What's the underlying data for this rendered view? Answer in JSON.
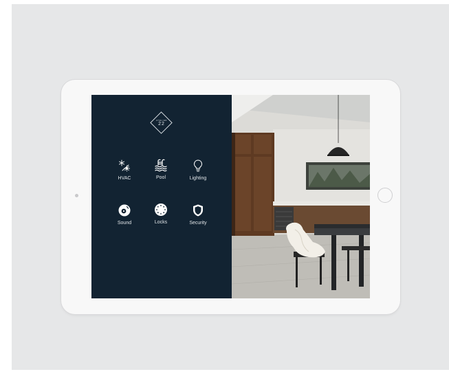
{
  "branding": {
    "logo_small_text": "ATELIER",
    "logo_number": "22"
  },
  "controls": [
    {
      "label": "HVAC",
      "icon": "snowflake-sun-icon"
    },
    {
      "label": "Pool",
      "icon": "pool-ladder-icon"
    },
    {
      "label": "Lighting",
      "icon": "lightbulb-icon"
    },
    {
      "label": "Sound",
      "icon": "speaker-icon"
    },
    {
      "label": "Locks",
      "icon": "lock-dial-icon"
    },
    {
      "label": "Security",
      "icon": "shield-icon"
    }
  ],
  "colors": {
    "panel_background": "#122332",
    "icon_text": "#ffffff",
    "device_frame": "#f8f8f8",
    "backdrop": "#e6e7e8"
  }
}
